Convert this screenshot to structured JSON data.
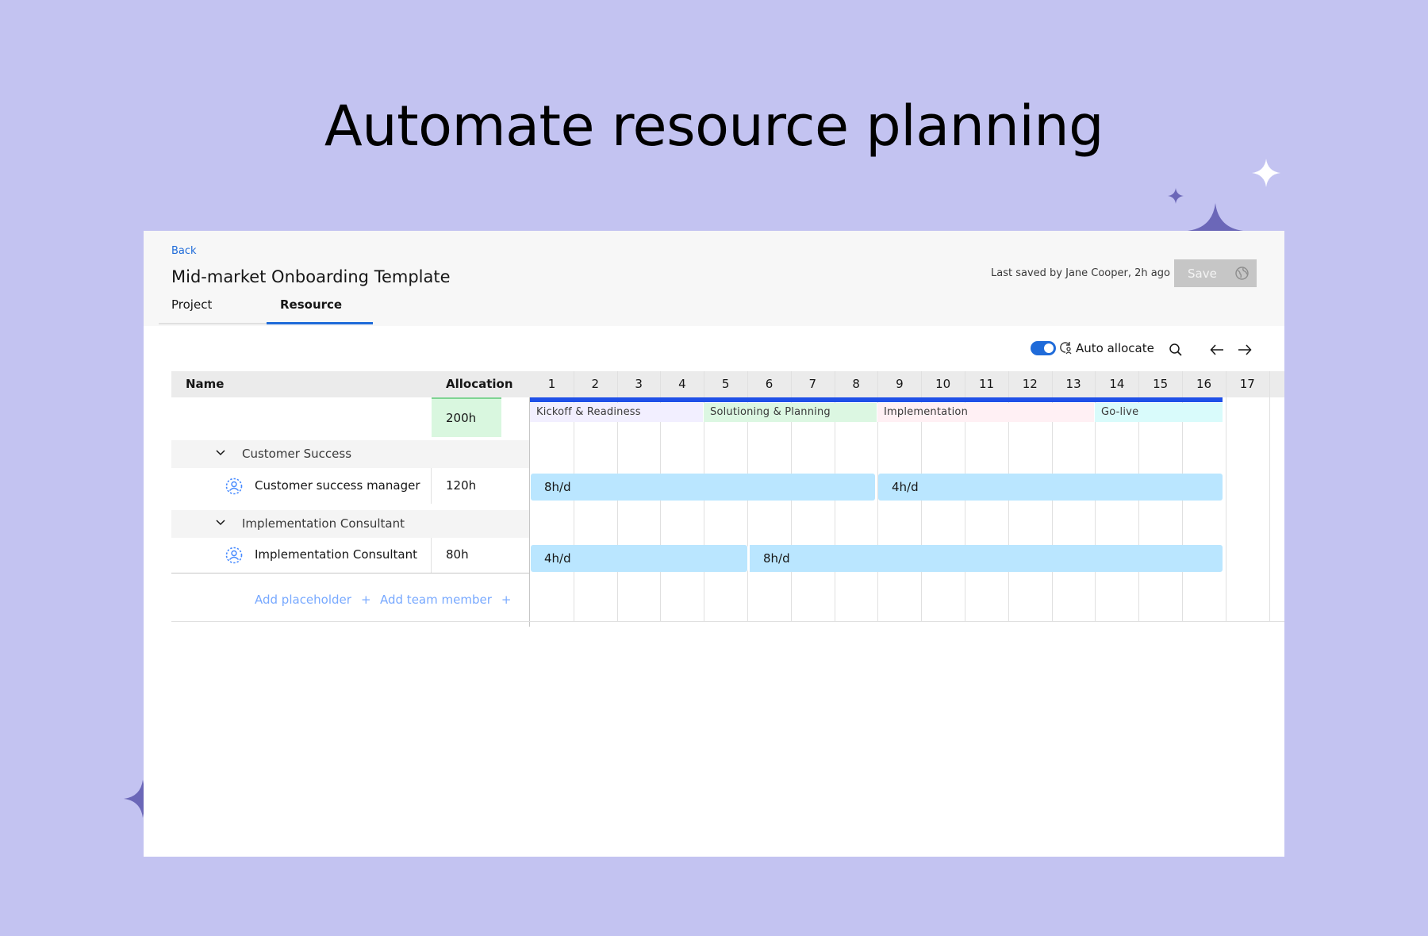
{
  "headline": "Automate resource planning",
  "header": {
    "back": "Back",
    "title": "Mid-market Onboarding Template",
    "save_status": "Last saved by Jane Cooper, 2h ago",
    "save_label": "Save"
  },
  "tabs": [
    {
      "label": "Project",
      "active": false
    },
    {
      "label": "Resource",
      "active": true
    }
  ],
  "toolbar": {
    "auto_allocate_label": "Auto allocate",
    "auto_allocate_on": true,
    "icons": [
      "toggle-icon",
      "auto-allocate-icon",
      "search-icon",
      "arrow-left-icon",
      "arrow-right-icon"
    ]
  },
  "grid": {
    "col_name": "Name",
    "col_allocation": "Allocation",
    "weeks": [
      "1",
      "2",
      "3",
      "4",
      "5",
      "6",
      "7",
      "8",
      "9",
      "10",
      "11",
      "12",
      "13",
      "14",
      "15",
      "16",
      "17"
    ],
    "total_allocation": "200h",
    "phases": [
      {
        "label": "Kickoff & Readiness",
        "color": "#f2efff"
      },
      {
        "label": "Solutioning & Planning",
        "color": "#dcf7e2"
      },
      {
        "label": "Implementation",
        "color": "#fff0f4"
      },
      {
        "label": "Go-live",
        "color": "#d9fbfb"
      }
    ],
    "groups": [
      {
        "label": "Customer Success",
        "member": {
          "name": "Customer success manager",
          "allocation": "120h"
        },
        "bars": [
          {
            "label": "8h/d"
          },
          {
            "label": "4h/d"
          }
        ]
      },
      {
        "label": "Implementation Consultant",
        "member": {
          "name": "Implementation Consultant",
          "allocation": "80h"
        },
        "bars": [
          {
            "label": "4h/d"
          },
          {
            "label": "8h/d"
          }
        ]
      }
    ],
    "add_placeholder": "Add placeholder",
    "add_team_member": "Add team member"
  },
  "colors": {
    "background": "#c3c3f1",
    "accent": "#1f6bd9",
    "bar": "#bae6ff",
    "sparkle": "#6b67b8"
  }
}
